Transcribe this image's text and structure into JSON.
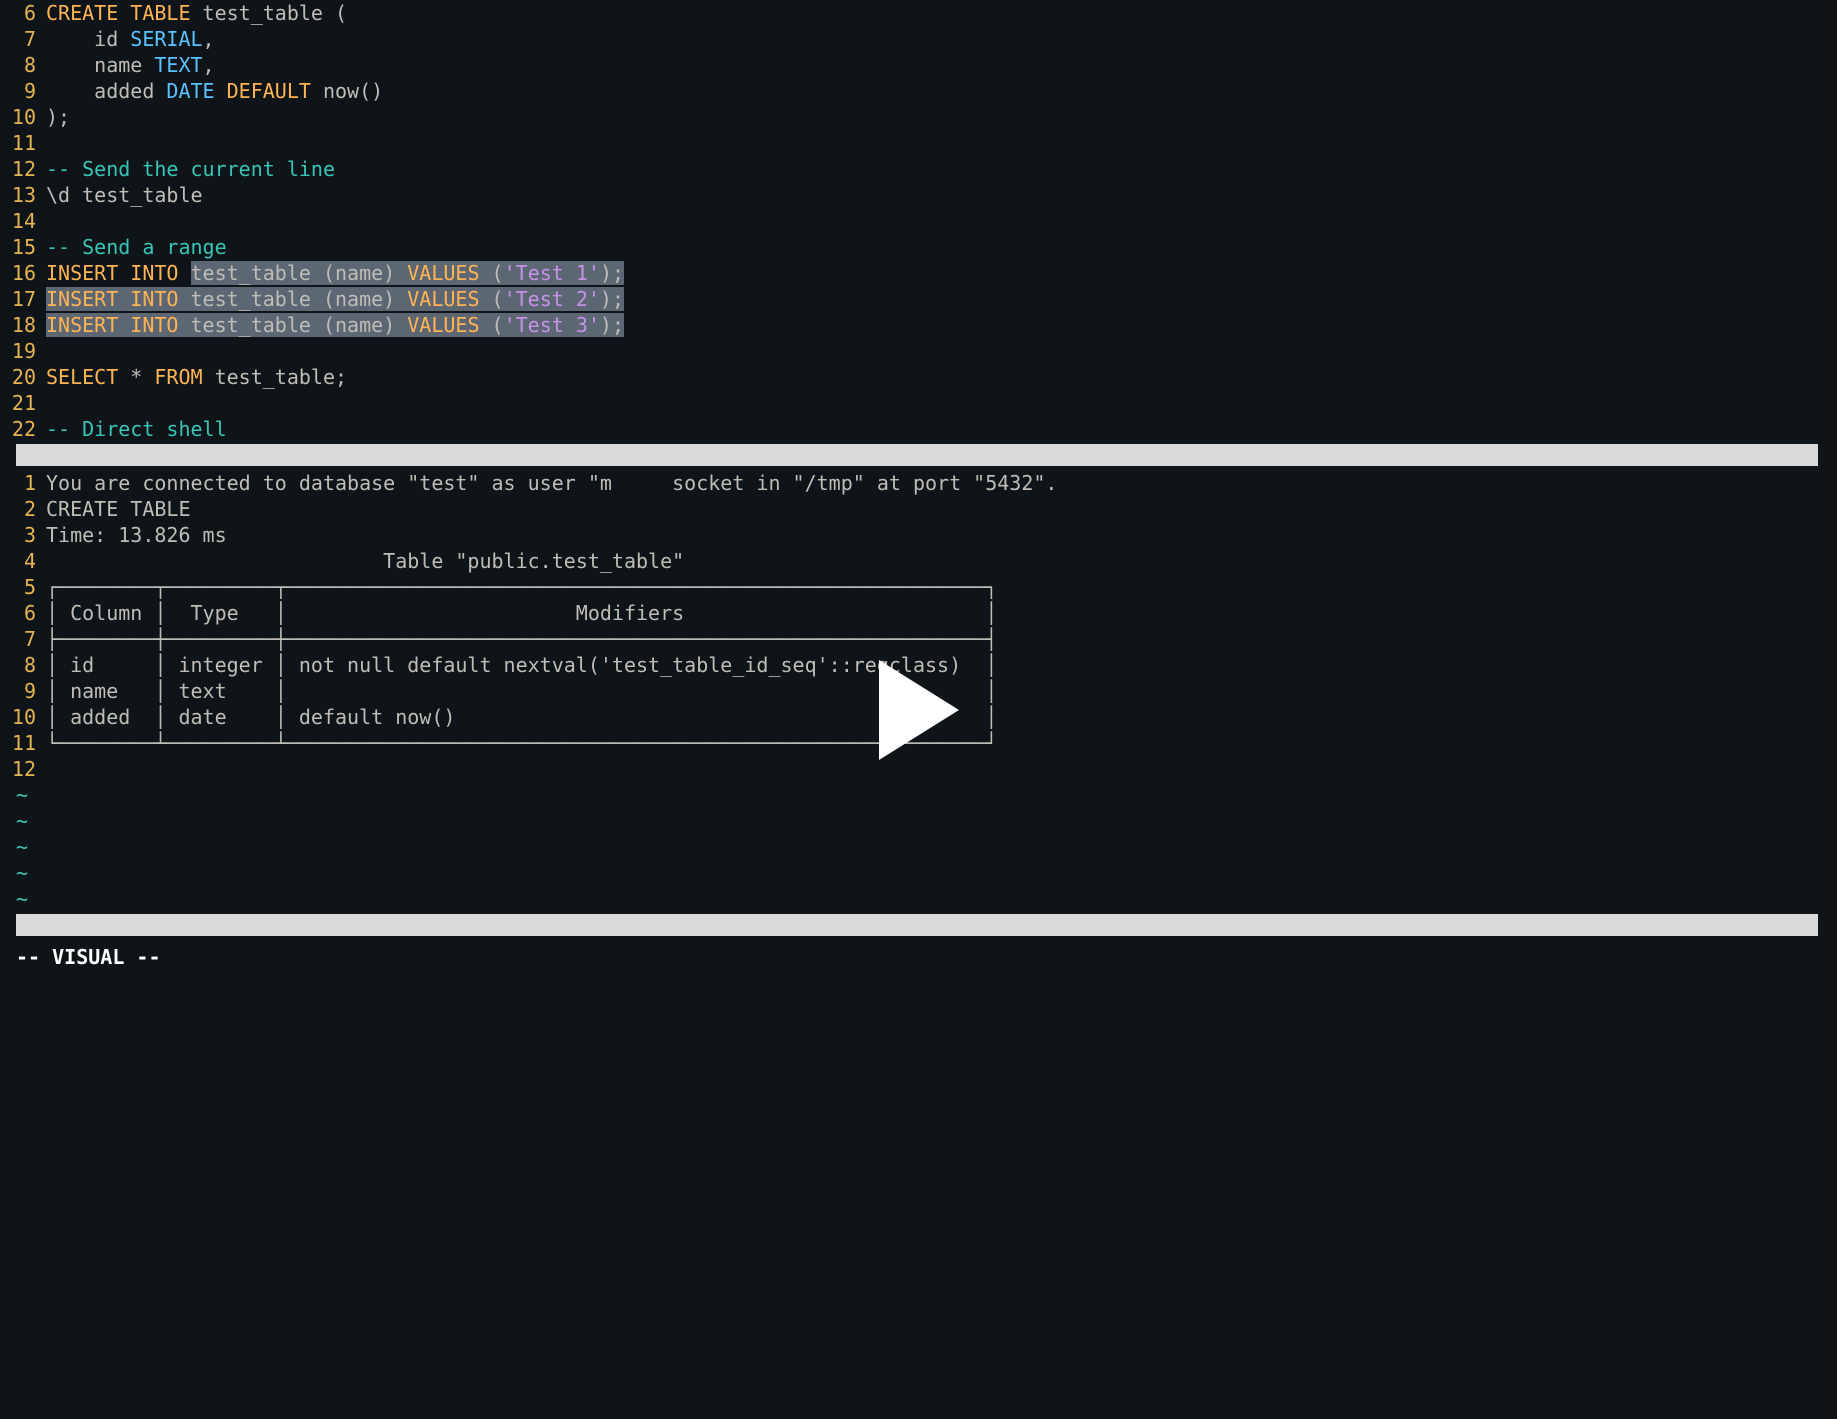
{
  "editor": {
    "lines": [
      {
        "n": 6,
        "tokens": [
          [
            "kw",
            "CREATE"
          ],
          [
            "default",
            " "
          ],
          [
            "kw",
            "TABLE"
          ],
          [
            "default",
            " test_table ("
          ]
        ]
      },
      {
        "n": 7,
        "tokens": [
          [
            "default",
            "    id "
          ],
          [
            "type",
            "SERIAL"
          ],
          [
            "default",
            ","
          ]
        ]
      },
      {
        "n": 8,
        "tokens": [
          [
            "default",
            "    name "
          ],
          [
            "type",
            "TEXT"
          ],
          [
            "default",
            ","
          ]
        ]
      },
      {
        "n": 9,
        "tokens": [
          [
            "default",
            "    added "
          ],
          [
            "type",
            "DATE"
          ],
          [
            "default",
            " "
          ],
          [
            "kw",
            "DEFAULT"
          ],
          [
            "default",
            " now()"
          ]
        ]
      },
      {
        "n": 10,
        "tokens": [
          [
            "default",
            ");"
          ]
        ]
      },
      {
        "n": 11,
        "tokens": [
          [
            "default",
            ""
          ]
        ]
      },
      {
        "n": 12,
        "tokens": [
          [
            "comment",
            "-- Send the current line"
          ]
        ]
      },
      {
        "n": 13,
        "tokens": [
          [
            "default",
            "\\d test_table"
          ]
        ]
      },
      {
        "n": 14,
        "tokens": [
          [
            "default",
            ""
          ]
        ]
      },
      {
        "n": 15,
        "tokens": [
          [
            "comment",
            "-- Send a range"
          ]
        ]
      },
      {
        "n": 16,
        "tokens": [
          [
            "kw",
            "INSERT"
          ],
          [
            "default",
            " "
          ],
          [
            "kw",
            "INTO"
          ],
          [
            "default",
            " "
          ],
          [
            "sel-start",
            ""
          ],
          [
            "default",
            "test_table (name) "
          ],
          [
            "kw",
            "VALUES"
          ],
          [
            "default",
            " ("
          ],
          [
            "str",
            "'Test 1'"
          ],
          [
            "default",
            ");"
          ]
        ],
        "selFrom": 2
      },
      {
        "n": 17,
        "tokens": [
          [
            "kw",
            "INSERT"
          ],
          [
            "default",
            " "
          ],
          [
            "kw",
            "INTO"
          ],
          [
            "default",
            " test_table (name) "
          ],
          [
            "kw",
            "VALUES"
          ],
          [
            "default",
            " ("
          ],
          [
            "str",
            "'Test 2'"
          ],
          [
            "default",
            ");"
          ]
        ],
        "selAll": true
      },
      {
        "n": 18,
        "tokens": [
          [
            "kw",
            "INSERT"
          ],
          [
            "default",
            " "
          ],
          [
            "kw",
            "INTO"
          ],
          [
            "default",
            " test_table (name) "
          ],
          [
            "kw",
            "VALUES"
          ],
          [
            "default",
            " ("
          ],
          [
            "str",
            "'Test 3'"
          ],
          [
            "default",
            ");"
          ]
        ],
        "selAll": true
      },
      {
        "n": 19,
        "tokens": [
          [
            "default",
            ""
          ]
        ]
      },
      {
        "n": 20,
        "tokens": [
          [
            "kw",
            "SELECT"
          ],
          [
            "default",
            " * "
          ],
          [
            "kw",
            "FROM"
          ],
          [
            "default",
            " test_table;"
          ]
        ]
      },
      {
        "n": 21,
        "tokens": [
          [
            "default",
            ""
          ]
        ]
      },
      {
        "n": 22,
        "tokens": [
          [
            "comment",
            "-- Direct shell"
          ]
        ]
      }
    ]
  },
  "output": {
    "lines": [
      {
        "n": 1,
        "text": "You are connected to database \"test\" as user \"m     socket in \"/tmp\" at port \"5432\"."
      },
      {
        "n": 2,
        "text": "CREATE TABLE"
      },
      {
        "n": 3,
        "text": "Time: 13.826 ms"
      },
      {
        "n": 4,
        "text": "                            Table \"public.test_table\""
      },
      {
        "n": 5,
        "text": "┌────────┬─────────┬──────────────────────────────────────────────────────────┐"
      },
      {
        "n": 6,
        "text": "│ Column │  Type   │                        Modifiers                         │"
      },
      {
        "n": 7,
        "text": "├────────┼─────────┼──────────────────────────────────────────────────────────┤"
      },
      {
        "n": 8,
        "text": "│ id     │ integer │ not null default nextval('test_table_id_seq'::regclass)  │"
      },
      {
        "n": 9,
        "text": "│ name   │ text    │                                                          │"
      },
      {
        "n": 10,
        "text": "│ added  │ date    │ default now()                                            │"
      },
      {
        "n": 11,
        "text": "└────────┴─────────┴──────────────────────────────────────────────────────────┘"
      },
      {
        "n": 12,
        "text": ""
      }
    ],
    "tildes": 5
  },
  "mode": "-- VISUAL --",
  "chart_data": {
    "type": "table",
    "title": "Table \"public.test_table\"",
    "columns": [
      "Column",
      "Type",
      "Modifiers"
    ],
    "rows": [
      [
        "id",
        "integer",
        "not null default nextval('test_table_id_seq'::regclass)"
      ],
      [
        "name",
        "text",
        ""
      ],
      [
        "added",
        "date",
        "default now()"
      ]
    ]
  }
}
